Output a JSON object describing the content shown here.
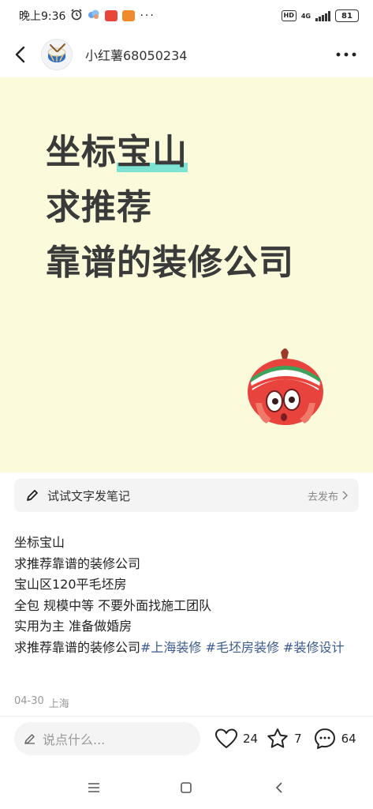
{
  "status_bar": {
    "time": "晚上9:36",
    "signal_type": "4G",
    "hd": "HD",
    "battery": "81"
  },
  "header": {
    "author_name": "小红薯68050234"
  },
  "cover": {
    "line1_prefix": "坐标",
    "line1_highlight": "宝山",
    "line2": "求推荐",
    "line3": "靠谱的装修公司",
    "highlight_color": "#7de3d2",
    "background_color": "#fbfbdc"
  },
  "note_bar": {
    "label": "试试文字发笔记",
    "action": "去发布"
  },
  "post": {
    "lines": [
      "坐标宝山",
      "求推荐靠谱的装修公司",
      "宝山区120平毛坯房",
      "全包 规模中等 不要外面找施工团队",
      "实用为主 准备做婚房"
    ],
    "last_line_text": "求推荐靠谱的装修公司",
    "tags": [
      "#上海装修",
      "#毛坯房装修",
      "#装修设计"
    ],
    "tag_color": "#3b5a8c",
    "date": "04-30",
    "location": "上海"
  },
  "actions": {
    "comment_placeholder": "说点什么...",
    "likes": "24",
    "collects": "7",
    "comments": "64"
  }
}
